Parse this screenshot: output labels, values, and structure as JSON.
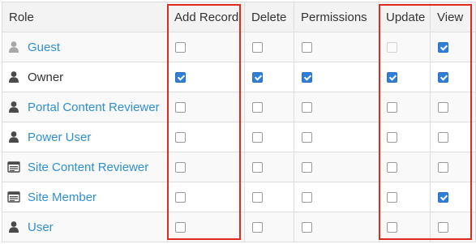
{
  "headers": [
    "Role",
    "Add Record",
    "Delete",
    "Permissions",
    "Update",
    "View"
  ],
  "rows": [
    {
      "role": "Guest",
      "icon": "guest-user-icon",
      "link": true,
      "checks": [
        "unchecked",
        "unchecked",
        "unchecked",
        "disabled",
        "checked"
      ]
    },
    {
      "role": "Owner",
      "icon": "user-icon",
      "link": false,
      "checks": [
        "checked",
        "checked",
        "checked",
        "checked",
        "checked"
      ]
    },
    {
      "role": "Portal Content Reviewer",
      "icon": "user-icon",
      "link": true,
      "checks": [
        "unchecked",
        "unchecked",
        "unchecked",
        "unchecked",
        "unchecked"
      ]
    },
    {
      "role": "Power User",
      "icon": "user-icon",
      "link": true,
      "checks": [
        "unchecked",
        "unchecked",
        "unchecked",
        "unchecked",
        "unchecked"
      ]
    },
    {
      "role": "Site Content Reviewer",
      "icon": "site-icon",
      "link": true,
      "checks": [
        "unchecked",
        "unchecked",
        "unchecked",
        "unchecked",
        "unchecked"
      ]
    },
    {
      "role": "Site Member",
      "icon": "site-icon",
      "link": true,
      "checks": [
        "unchecked",
        "unchecked",
        "unchecked",
        "unchecked",
        "checked"
      ]
    },
    {
      "role": "User",
      "icon": "user-icon",
      "link": true,
      "checks": [
        "unchecked",
        "unchecked",
        "unchecked",
        "unchecked",
        "unchecked"
      ]
    }
  ],
  "colors": {
    "link": "#2f8fd1",
    "highlight": "#e02a20",
    "checkbox_checked": "#2f7fd9"
  }
}
